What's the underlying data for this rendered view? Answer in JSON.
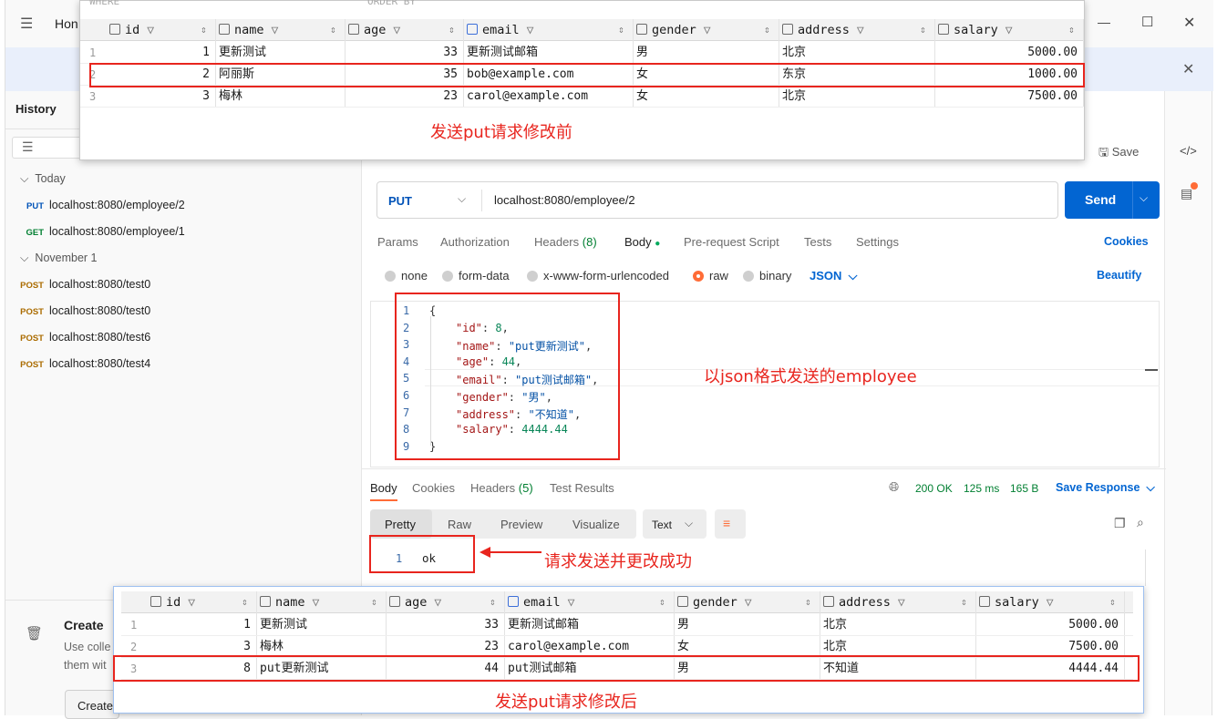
{
  "titlebar": {
    "title_partial": "Hon",
    "menu_icon": "hamburger",
    "minimize": "—",
    "maximize": "☐",
    "close": "✕"
  },
  "sidebar": {
    "header": "History",
    "sections": [
      {
        "label": "Today",
        "items": [
          {
            "method": "PUT",
            "url": "localhost:8080/employee/2"
          },
          {
            "method": "GET",
            "url": "localhost:8080/employee/1"
          }
        ]
      },
      {
        "label": "November 1",
        "items": [
          {
            "method": "POST",
            "url": "localhost:8080/test0"
          },
          {
            "method": "POST",
            "url": "localhost:8080/test0"
          },
          {
            "method": "POST",
            "url": "localhost:8080/test6"
          },
          {
            "method": "POST",
            "url": "localhost:8080/test4"
          }
        ]
      }
    ],
    "create_title": "Create",
    "create_desc_1": "Use colle",
    "create_desc_2": "them wit",
    "create_button": "Create"
  },
  "request": {
    "save_label": "Save",
    "method": "PUT",
    "url": "localhost:8080/employee/2",
    "send_label": "Send",
    "tabs": {
      "params": "Params",
      "authorization": "Authorization",
      "headers": "Headers",
      "headers_count": "(8)",
      "body": "Body",
      "pre_request": "Pre-request Script",
      "tests": "Tests",
      "settings": "Settings",
      "cookies": "Cookies"
    },
    "body_types": {
      "none": "none",
      "form_data": "form-data",
      "urlencoded": "x-www-form-urlencoded",
      "raw": "raw",
      "binary": "binary",
      "format": "JSON",
      "beautify": "Beautify"
    },
    "code_lines": [
      {
        "num": "1",
        "key": "",
        "value": "",
        "open": "{"
      },
      {
        "num": "2",
        "key": "\"id\"",
        "value": "8",
        "type": "n"
      },
      {
        "num": "3",
        "key": "\"name\"",
        "value": "\"put更新测试\"",
        "type": "s"
      },
      {
        "num": "4",
        "key": "\"age\"",
        "value": "44",
        "type": "n"
      },
      {
        "num": "5",
        "key": "\"email\"",
        "value": "\"put测试邮箱\"",
        "type": "s"
      },
      {
        "num": "6",
        "key": "\"gender\"",
        "value": "\"男\"",
        "type": "s"
      },
      {
        "num": "7",
        "key": "\"address\"",
        "value": "\"不知道\"",
        "type": "s"
      },
      {
        "num": "8",
        "key": "\"salary\"",
        "value": "4444.44",
        "type": "n"
      },
      {
        "num": "9",
        "key": "",
        "value": "",
        "open": "}"
      }
    ]
  },
  "response": {
    "tabs": {
      "body": "Body",
      "cookies": "Cookies",
      "headers": "Headers",
      "headers_count": "(5)",
      "test_results": "Test Results"
    },
    "status": "200 OK",
    "time": "125 ms",
    "size": "165 B",
    "save_response": "Save Response",
    "view_tabs": {
      "pretty": "Pretty",
      "raw": "Raw",
      "preview": "Preview",
      "visualize": "Visualize",
      "format": "Text"
    },
    "body_line_num": "1",
    "body_text": "ok"
  },
  "db_before": {
    "faded_header_left": "WHERE",
    "faded_header_right": "ORDER BY",
    "columns": [
      "id",
      "name",
      "age",
      "email",
      "gender",
      "address",
      "salary"
    ],
    "rows": [
      {
        "n": "1",
        "id": "1",
        "name": "更新测试",
        "age": "33",
        "email": "更新测试邮箱",
        "gender": "男",
        "address": "北京",
        "salary": "5000.00"
      },
      {
        "n": "2",
        "id": "2",
        "name": "阿丽斯",
        "age": "35",
        "email": "bob@example.com",
        "gender": "女",
        "address": "东京",
        "salary": "1000.00"
      },
      {
        "n": "3",
        "id": "3",
        "name": "梅林",
        "age": "23",
        "email": "carol@example.com",
        "gender": "女",
        "address": "北京",
        "salary": "7500.00"
      }
    ]
  },
  "db_after": {
    "columns": [
      "id",
      "name",
      "age",
      "email",
      "gender",
      "address",
      "salary"
    ],
    "rows": [
      {
        "n": "1",
        "id": "1",
        "name": "更新测试",
        "age": "33",
        "email": "更新测试邮箱",
        "gender": "男",
        "address": "北京",
        "salary": "5000.00"
      },
      {
        "n": "2",
        "id": "3",
        "name": "梅林",
        "age": "23",
        "email": "carol@example.com",
        "gender": "女",
        "address": "北京",
        "salary": "7500.00"
      },
      {
        "n": "3",
        "id": "8",
        "name": "put更新测试",
        "age": "44",
        "email": "put测试邮箱",
        "gender": "男",
        "address": "不知道",
        "salary": "4444.44"
      }
    ]
  },
  "annotations": {
    "before": "发送put请求修改前",
    "json": "以json格式发送的employee",
    "success": "请求发送并更改成功",
    "after": "发送put请求修改后"
  },
  "colors": {
    "accent": "#0265d2",
    "annotation": "#e8251e",
    "status_ok": "#007f31",
    "postman_orange": "#ff6c37"
  }
}
